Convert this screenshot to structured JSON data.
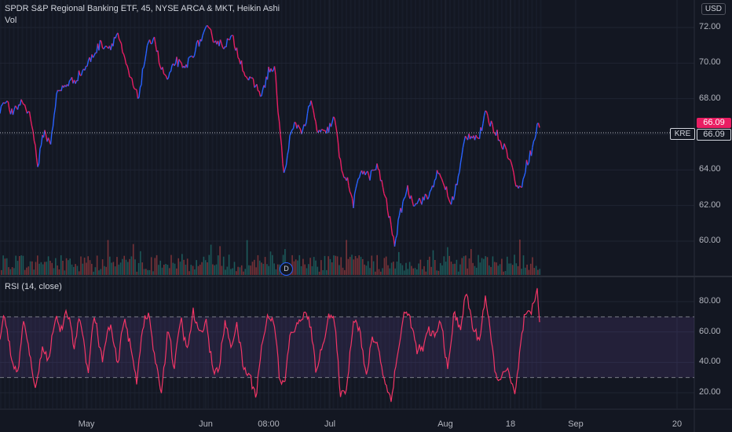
{
  "header": {
    "title": "SPDR S&P Regional Banking ETF, 45, NYSE ARCA & MKT, Heikin Ashi",
    "vol_label": "Vol",
    "currency": "USD"
  },
  "rsi_header": {
    "label": "RSI (14, close)"
  },
  "badges": {
    "symbol": "KRE",
    "last_price": "66.09",
    "last_close": "66.09",
    "dividend_marker": "D"
  },
  "colors": {
    "up": "#2962ff",
    "down": "#e91e63",
    "rsi_line": "#f23566",
    "rsi_band": "#7e57c2",
    "vol_up": "#26a69a",
    "vol_down": "#ef5350",
    "background": "#131722"
  },
  "chart_data": [
    {
      "type": "line",
      "name": "Heikin Ashi price",
      "y_ticks": [
        "72.00",
        "70.00",
        "68.00",
        "66.00",
        "64.00",
        "62.00",
        "60.00"
      ],
      "ylim": [
        58.2,
        72.7
      ],
      "x_ticks": [
        "May",
        "Jun",
        "08:00",
        "Jul",
        "Aug",
        "18",
        "Sep",
        "20"
      ],
      "last_value": 66.09,
      "keypoints": [
        [
          0,
          67.4
        ],
        [
          6,
          68.0
        ],
        [
          16,
          67.1
        ],
        [
          28,
          67.9
        ],
        [
          40,
          66.9
        ],
        [
          48,
          64.2
        ],
        [
          56,
          66.2
        ],
        [
          64,
          65.4
        ],
        [
          72,
          68.2
        ],
        [
          84,
          68.8
        ],
        [
          96,
          69.1
        ],
        [
          108,
          69.7
        ],
        [
          118,
          70.4
        ],
        [
          128,
          71.1
        ],
        [
          140,
          70.9
        ],
        [
          150,
          71.7
        ],
        [
          158,
          70.2
        ],
        [
          168,
          68.9
        ],
        [
          176,
          68.0
        ],
        [
          186,
          70.6
        ],
        [
          196,
          71.6
        ],
        [
          204,
          69.8
        ],
        [
          214,
          69.0
        ],
        [
          224,
          70.2
        ],
        [
          234,
          69.6
        ],
        [
          244,
          70.4
        ],
        [
          254,
          71.2
        ],
        [
          264,
          71.9
        ],
        [
          274,
          71.3
        ],
        [
          284,
          71.0
        ],
        [
          296,
          71.4
        ],
        [
          306,
          70.2
        ],
        [
          314,
          69.2
        ],
        [
          324,
          68.8
        ],
        [
          334,
          68.2
        ],
        [
          342,
          69.6
        ],
        [
          350,
          69.6
        ],
        [
          356,
          66.4
        ],
        [
          362,
          63.5
        ],
        [
          368,
          65.6
        ],
        [
          376,
          66.6
        ],
        [
          386,
          66.2
        ],
        [
          396,
          67.8
        ],
        [
          404,
          66.2
        ],
        [
          414,
          66.0
        ],
        [
          426,
          66.9
        ],
        [
          434,
          64.2
        ],
        [
          442,
          63.4
        ],
        [
          450,
          62.1
        ],
        [
          460,
          64.1
        ],
        [
          470,
          63.6
        ],
        [
          480,
          64.2
        ],
        [
          488,
          63.0
        ],
        [
          496,
          61.3
        ],
        [
          502,
          59.8
        ],
        [
          510,
          61.6
        ],
        [
          518,
          63.0
        ],
        [
          526,
          62.2
        ],
        [
          536,
          62.3
        ],
        [
          546,
          62.5
        ],
        [
          556,
          63.8
        ],
        [
          566,
          63.2
        ],
        [
          574,
          62.0
        ],
        [
          584,
          63.6
        ],
        [
          592,
          65.8
        ],
        [
          600,
          66.0
        ],
        [
          610,
          65.8
        ],
        [
          618,
          67.1
        ],
        [
          628,
          66.4
        ],
        [
          638,
          65.6
        ],
        [
          648,
          64.8
        ],
        [
          656,
          63.4
        ],
        [
          662,
          62.8
        ],
        [
          670,
          64.3
        ],
        [
          678,
          65.2
        ],
        [
          686,
          66.8
        ],
        [
          688,
          66.1
        ]
      ]
    },
    {
      "type": "line",
      "name": "RSI (14, close)",
      "y_ticks": [
        "80.00",
        "60.00",
        "40.00",
        "20.00"
      ],
      "ylim": [
        13,
        91
      ],
      "upper_band": 70,
      "lower_band": 30,
      "keypoints": [
        [
          0,
          56
        ],
        [
          6,
          72
        ],
        [
          14,
          44
        ],
        [
          22,
          31
        ],
        [
          30,
          67
        ],
        [
          38,
          44
        ],
        [
          46,
          22
        ],
        [
          54,
          52
        ],
        [
          62,
          40
        ],
        [
          70,
          71
        ],
        [
          78,
          61
        ],
        [
          86,
          74
        ],
        [
          94,
          50
        ],
        [
          102,
          70
        ],
        [
          112,
          34
        ],
        [
          120,
          72
        ],
        [
          130,
          41
        ],
        [
          140,
          66
        ],
        [
          150,
          37
        ],
        [
          158,
          71
        ],
        [
          166,
          50
        ],
        [
          174,
          28
        ],
        [
          182,
          66
        ],
        [
          190,
          71
        ],
        [
          198,
          38
        ],
        [
          206,
          21
        ],
        [
          214,
          64
        ],
        [
          222,
          35
        ],
        [
          230,
          70
        ],
        [
          238,
          46
        ],
        [
          246,
          73
        ],
        [
          254,
          57
        ],
        [
          262,
          69
        ],
        [
          270,
          38
        ],
        [
          278,
          32
        ],
        [
          286,
          66
        ],
        [
          294,
          52
        ],
        [
          302,
          64
        ],
        [
          310,
          36
        ],
        [
          318,
          31
        ],
        [
          326,
          18
        ],
        [
          334,
          54
        ],
        [
          342,
          72
        ],
        [
          350,
          66
        ],
        [
          356,
          27
        ],
        [
          362,
          25
        ],
        [
          370,
          60
        ],
        [
          378,
          63
        ],
        [
          386,
          72
        ],
        [
          394,
          68
        ],
        [
          402,
          36
        ],
        [
          410,
          48
        ],
        [
          418,
          72
        ],
        [
          426,
          66
        ],
        [
          434,
          17
        ],
        [
          442,
          25
        ],
        [
          450,
          70
        ],
        [
          458,
          62
        ],
        [
          466,
          29
        ],
        [
          474,
          57
        ],
        [
          482,
          50
        ],
        [
          490,
          26
        ],
        [
          498,
          16
        ],
        [
          506,
          44
        ],
        [
          514,
          72
        ],
        [
          522,
          70
        ],
        [
          530,
          49
        ],
        [
          538,
          48
        ],
        [
          546,
          61
        ],
        [
          554,
          57
        ],
        [
          562,
          68
        ],
        [
          570,
          33
        ],
        [
          578,
          72
        ],
        [
          586,
          63
        ],
        [
          594,
          86
        ],
        [
          602,
          63
        ],
        [
          610,
          54
        ],
        [
          618,
          84
        ],
        [
          626,
          51
        ],
        [
          634,
          24
        ],
        [
          640,
          36
        ],
        [
          648,
          32
        ],
        [
          656,
          17
        ],
        [
          662,
          48
        ],
        [
          668,
          70
        ],
        [
          676,
          71
        ],
        [
          684,
          88
        ],
        [
          688,
          63
        ]
      ]
    }
  ]
}
